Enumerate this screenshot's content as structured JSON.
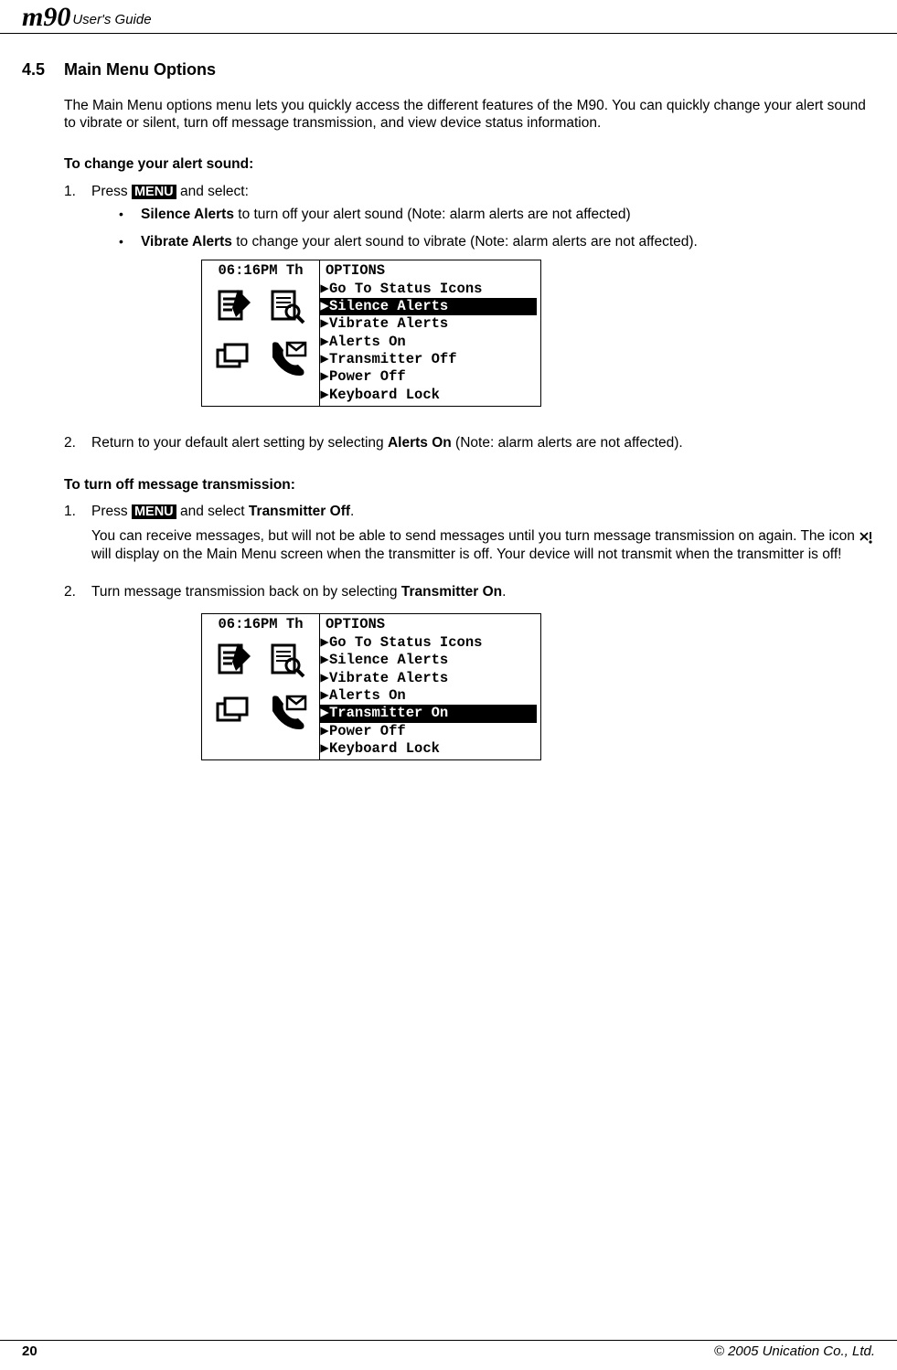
{
  "header": {
    "logo": "m90",
    "title": "User's Guide"
  },
  "section": {
    "number": "4.5",
    "title": "Main Menu Options"
  },
  "intro": "The Main Menu options menu lets you quickly access the different features of the M90. You can quickly change your alert sound to vibrate or silent, turn off message transmission, and view device status information.",
  "change_alert": {
    "heading": "To change your alert sound:",
    "step1_pre": "Press ",
    "menu_key": "MENU",
    "step1_post": " and select:",
    "silence_label": "Silence Alerts",
    "silence_text": " to turn off your alert sound (Note: alarm alerts are not affected)",
    "vibrate_label": "Vibrate Alerts",
    "vibrate_text": " to change your alert sound to vibrate (Note: alarm alerts are not affected).",
    "step2_pre": "Return to your default alert setting by selecting ",
    "alerts_on_label": "Alerts On",
    "step2_post": " (Note: alarm alerts are not affected)."
  },
  "screen1": {
    "time": "06:16PM Th",
    "options_label": " OPTIONS",
    "items": [
      "Go To Status Icons",
      "Silence Alerts",
      "Vibrate Alerts",
      "Alerts On",
      "Transmitter Off",
      "Power Off",
      "Keyboard Lock"
    ],
    "selected_index": 1
  },
  "tx_off": {
    "heading": "To turn off message transmission:",
    "step1_pre": "Press ",
    "menu_key": "MENU",
    "step1_mid": " and select ",
    "transmitter_off_label": "Transmitter Off",
    "step1_post": ".",
    "note_pre": "You can receive messages, but will not be able to send messages until you turn message transmission on again. The icon ",
    "note_post": " will display on the Main Menu screen when the transmitter is off. Your device will not transmit when the transmitter is off!",
    "step2_pre": "Turn message transmission back on by selecting ",
    "transmitter_on_label": "Transmitter On",
    "step2_post": "."
  },
  "screen2": {
    "time": "06:16PM Th",
    "options_label": " OPTIONS",
    "items": [
      "Go To Status Icons",
      "Silence Alerts",
      "Vibrate Alerts",
      "Alerts On",
      "Transmitter On",
      "Power Off",
      "Keyboard Lock"
    ],
    "selected_index": 4
  },
  "footer": {
    "page": "20",
    "copyright": "© 2005 Unication Co., Ltd."
  }
}
